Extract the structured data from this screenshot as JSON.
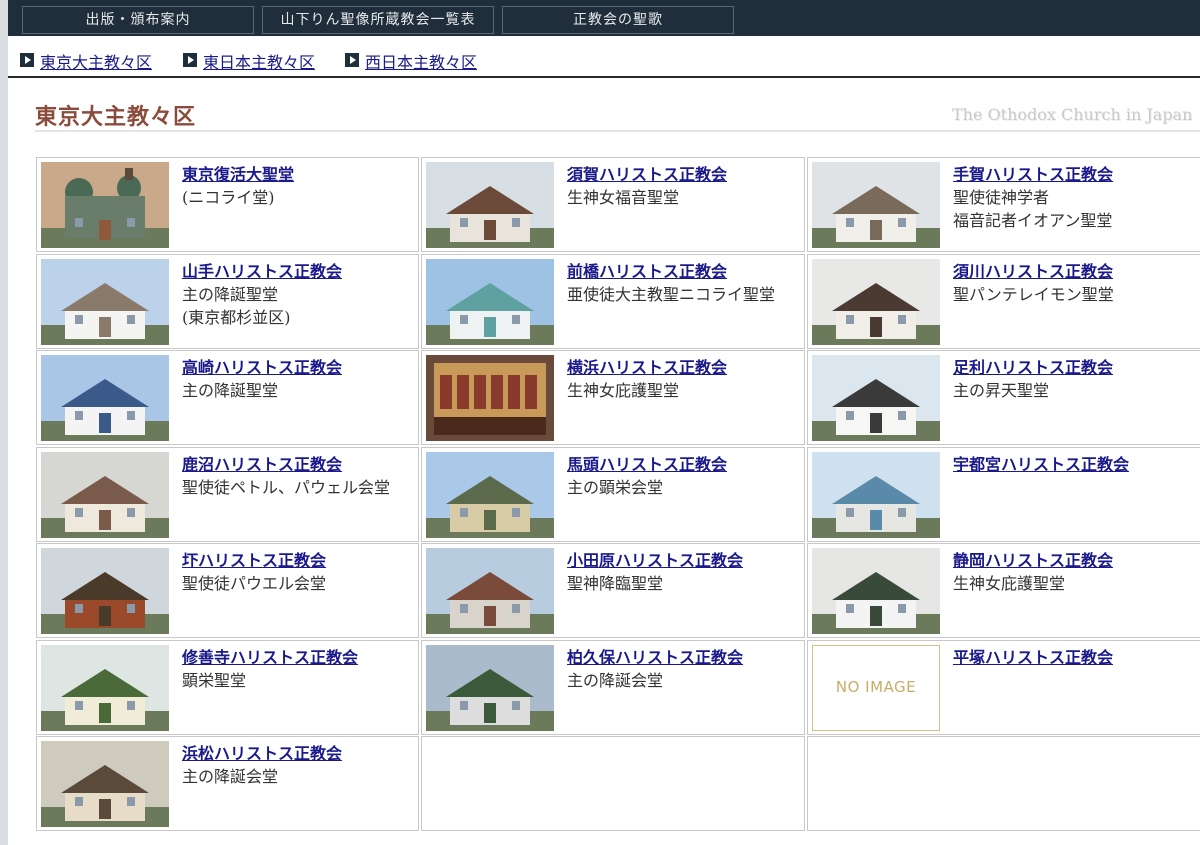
{
  "top_nav": [
    "出版・頒布案内",
    "山下りん聖像所蔵教会一覧表",
    "正教会の聖歌"
  ],
  "sub_nav": [
    "東京大主教々区",
    "東日本主教々区",
    "西日本主教々区"
  ],
  "heading": "東京大主教々区",
  "subtitle": "The Othodox Church in Japan",
  "no_image_label": "NO IMAGE",
  "churches": [
    {
      "name": "東京復活大聖堂",
      "lines": [
        "(ニコライ堂)",
        ""
      ],
      "icon": "cathedral-photo"
    },
    {
      "name": "須賀ハリストス正教会",
      "lines": [
        "生神女福音聖堂",
        ""
      ],
      "icon": "church-photo"
    },
    {
      "name": "手賀ハリストス正教会",
      "lines": [
        "聖使徒神学者",
        "福音記者イオアン聖堂"
      ],
      "icon": "church-photo"
    },
    {
      "name": "山手ハリストス正教会",
      "lines": [
        "主の降誕聖堂",
        "(東京都杉並区)"
      ],
      "icon": "church-photo"
    },
    {
      "name": "前橋ハリストス正教会",
      "lines": [
        "亜使徒大主教聖ニコライ聖堂",
        ""
      ],
      "icon": "church-photo"
    },
    {
      "name": "須川ハリストス正教会",
      "lines": [
        "聖パンテレイモン聖堂",
        ""
      ],
      "icon": "church-photo"
    },
    {
      "name": "高崎ハリストス正教会",
      "lines": [
        "主の降誕聖堂",
        ""
      ],
      "icon": "church-photo"
    },
    {
      "name": "横浜ハリストス正教会",
      "lines": [
        "生神女庇護聖堂",
        ""
      ],
      "icon": "iconostasis-photo"
    },
    {
      "name": "足利ハリストス正教会",
      "lines": [
        "主の昇天聖堂",
        ""
      ],
      "icon": "church-photo"
    },
    {
      "name": "鹿沼ハリストス正教会",
      "lines": [
        "聖使徒ペトル、パウェル会堂",
        ""
      ],
      "icon": "church-photo"
    },
    {
      "name": "馬頭ハリストス正教会",
      "lines": [
        "主の顕栄会堂",
        ""
      ],
      "icon": "church-photo"
    },
    {
      "name": "宇都宮ハリストス正教会",
      "lines": [
        "",
        ""
      ],
      "icon": "church-photo"
    },
    {
      "name": "圷ハリストス正教会",
      "lines": [
        "聖使徒パウエル会堂",
        ""
      ],
      "icon": "church-photo"
    },
    {
      "name": "小田原ハリストス正教会",
      "lines": [
        "聖神降臨聖堂",
        ""
      ],
      "icon": "church-photo"
    },
    {
      "name": "静岡ハリストス正教会",
      "lines": [
        "生神女庇護聖堂",
        ""
      ],
      "icon": "church-photo"
    },
    {
      "name": "修善寺ハリストス正教会",
      "lines": [
        "顕栄聖堂",
        ""
      ],
      "icon": "church-photo"
    },
    {
      "name": "柏久保ハリストス正教会",
      "lines": [
        "主の降誕会堂",
        ""
      ],
      "icon": "church-photo"
    },
    {
      "name": "平塚ハリストス正教会",
      "lines": [
        "",
        ""
      ],
      "icon": "no-image"
    },
    {
      "name": "浜松ハリストス正教会",
      "lines": [
        "主の降誕会堂",
        ""
      ],
      "icon": "church-photo"
    }
  ],
  "colors": {
    "nav_bg": "#1f2e3a",
    "link": "#1a1a8c",
    "heading": "#8b4a3a"
  }
}
